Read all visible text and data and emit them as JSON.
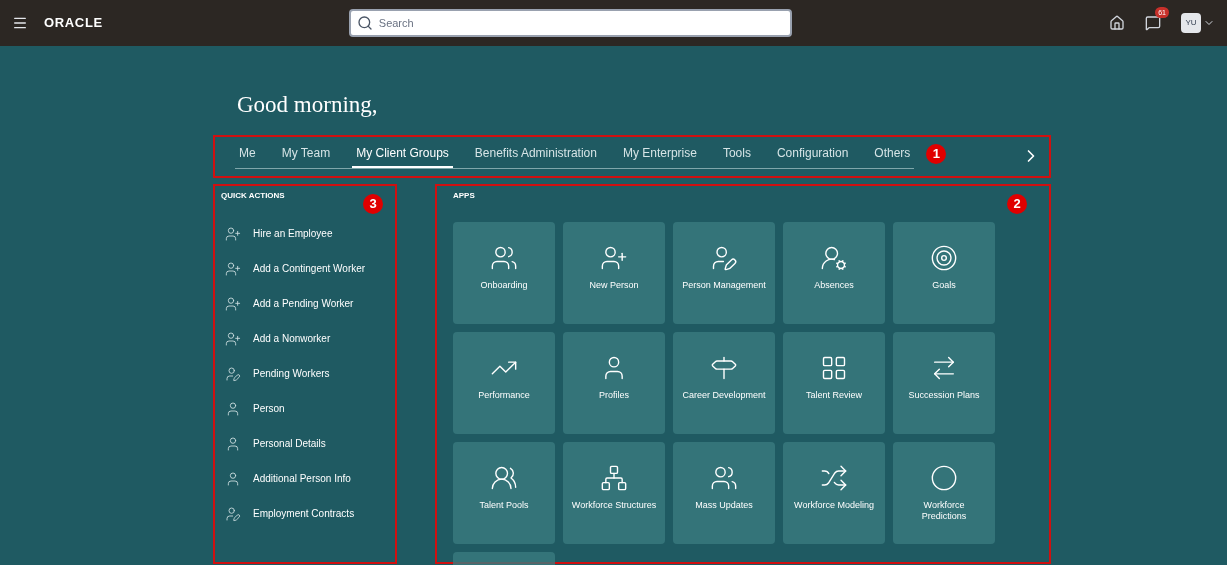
{
  "header": {
    "logo": "ORACLE",
    "search": {
      "placeholder": "Search"
    },
    "notification_count": "61",
    "avatar": "YU"
  },
  "greeting": "Good morning,",
  "tabs": [
    {
      "label": "Me",
      "selected": false
    },
    {
      "label": "My Team",
      "selected": false
    },
    {
      "label": "My Client Groups",
      "selected": true
    },
    {
      "label": "Benefits Administration",
      "selected": false
    },
    {
      "label": "My Enterprise",
      "selected": false
    },
    {
      "label": "Tools",
      "selected": false
    },
    {
      "label": "Configuration",
      "selected": false
    },
    {
      "label": "Others",
      "selected": false
    }
  ],
  "annotations": {
    "tabs": "1",
    "apps": "2",
    "quick_actions": "3"
  },
  "quick_actions": {
    "title": "QUICK ACTIONS",
    "items": [
      {
        "label": "Hire an Employee",
        "kind": "add"
      },
      {
        "label": "Add a Contingent Worker",
        "kind": "add"
      },
      {
        "label": "Add a Pending Worker",
        "kind": "add"
      },
      {
        "label": "Add a Nonworker",
        "kind": "add"
      },
      {
        "label": "Pending Workers",
        "kind": "edit"
      },
      {
        "label": "Person",
        "kind": "person"
      },
      {
        "label": "Personal Details",
        "kind": "person"
      },
      {
        "label": "Additional Person Info",
        "kind": "person"
      },
      {
        "label": "Employment Contracts",
        "kind": "edit"
      }
    ]
  },
  "apps": {
    "title": "APPS",
    "tiles": [
      {
        "label": "Onboarding",
        "kind": "onboarding"
      },
      {
        "label": "New Person",
        "kind": "new-person"
      },
      {
        "label": "Person Management",
        "kind": "person-edit"
      },
      {
        "label": "Absences",
        "kind": "absence"
      },
      {
        "label": "Goals",
        "kind": "goal"
      },
      {
        "label": "Performance",
        "kind": "performance"
      },
      {
        "label": "Profiles",
        "kind": "profile"
      },
      {
        "label": "Career Development",
        "kind": "signpost"
      },
      {
        "label": "Talent Review",
        "kind": "review"
      },
      {
        "label": "Succession Plans",
        "kind": "succession"
      },
      {
        "label": "Talent Pools",
        "kind": "pool"
      },
      {
        "label": "Workforce Structures",
        "kind": "structure"
      },
      {
        "label": "Mass Updates",
        "kind": "mass"
      },
      {
        "label": "Workforce Modeling",
        "kind": "modeling"
      },
      {
        "label": "Workforce Predictions",
        "kind": "crystal"
      }
    ]
  }
}
